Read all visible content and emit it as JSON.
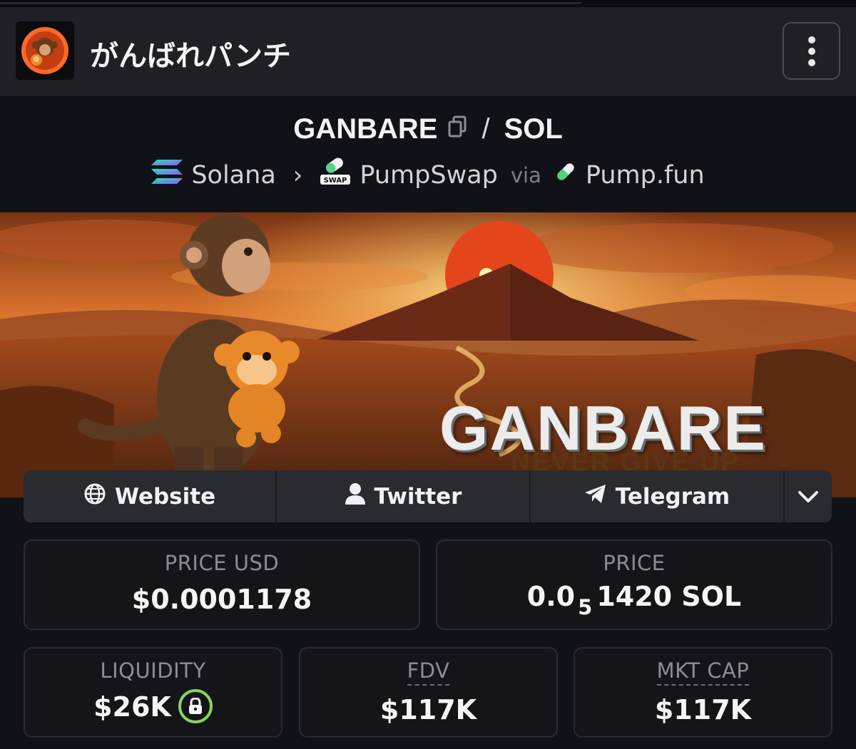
{
  "header": {
    "token_name": "がんばれパンチ",
    "avatar_icon": "monkey-avatar-icon",
    "menu_icon": "vertical-dots-icon"
  },
  "pair": {
    "base": "GANBARE",
    "quote": "SOL",
    "separator": "/",
    "chain": "Solana",
    "dex": "PumpSwap",
    "dex_badge": "SWAP",
    "via_label": "via",
    "launchpad": "Pump.fun"
  },
  "banner": {
    "title": "GANBARE",
    "subtitle": "NEVER GIVE UP"
  },
  "links": {
    "website": "Website",
    "twitter": "Twitter",
    "telegram": "Telegram"
  },
  "stats": {
    "price_usd_label": "PRICE USD",
    "price_usd_value": "$0.0001178",
    "price_label": "PRICE",
    "price_prefix": "0.0",
    "price_zeros": "5",
    "price_digits": "1420 SOL",
    "liquidity_label": "LIQUIDITY",
    "liquidity_value": "$26K",
    "fdv_label": "FDV",
    "fdv_value": "$117K",
    "mktcap_label": "MKT CAP",
    "mktcap_value": "$117K"
  },
  "colors": {
    "background": "#111118",
    "header_bg": "#1f1f25",
    "card_border": "#2b2b32",
    "lock_ring": "#8bd45a"
  }
}
